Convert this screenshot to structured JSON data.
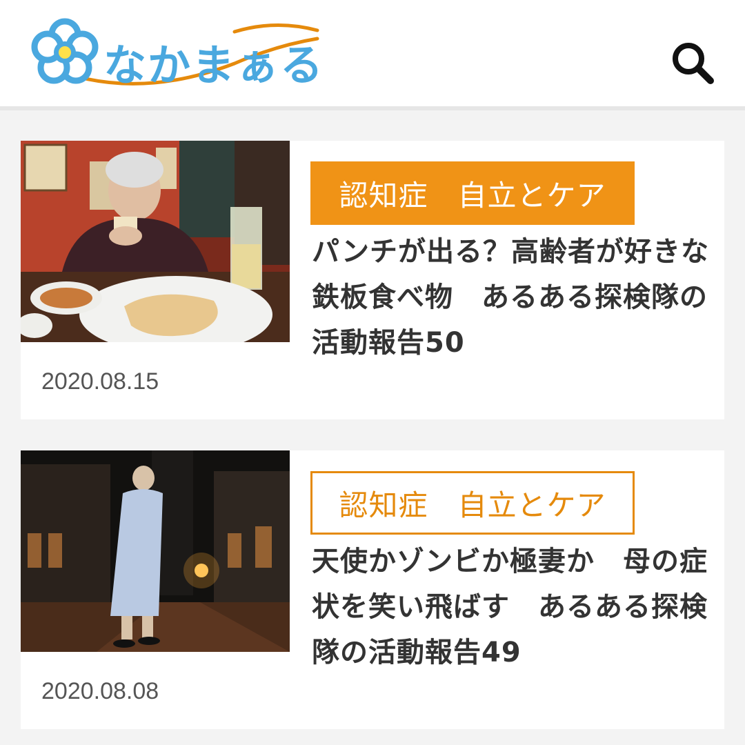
{
  "header": {
    "logo_text": "なかまぁる",
    "search_icon": "search-icon"
  },
  "colors": {
    "brand_blue": "#4aa8df",
    "accent_orange": "#f09316",
    "title_text": "#333333"
  },
  "articles": [
    {
      "category": "認知症　自立とケア",
      "category_style": "filled",
      "title": "パンチが出る？高齢者が好きな鉄板食べ物　あるある探検隊の活動報告50",
      "date": "2020.08.15",
      "image": "restaurant-photo"
    },
    {
      "category": "認知症　自立とケア",
      "category_style": "outlined",
      "title": "天使かゾンビか極妻か　母の症状を笑い飛ばす　あるある探検隊の活動報告49",
      "date": "2020.08.08",
      "image": "night-street-photo"
    }
  ]
}
